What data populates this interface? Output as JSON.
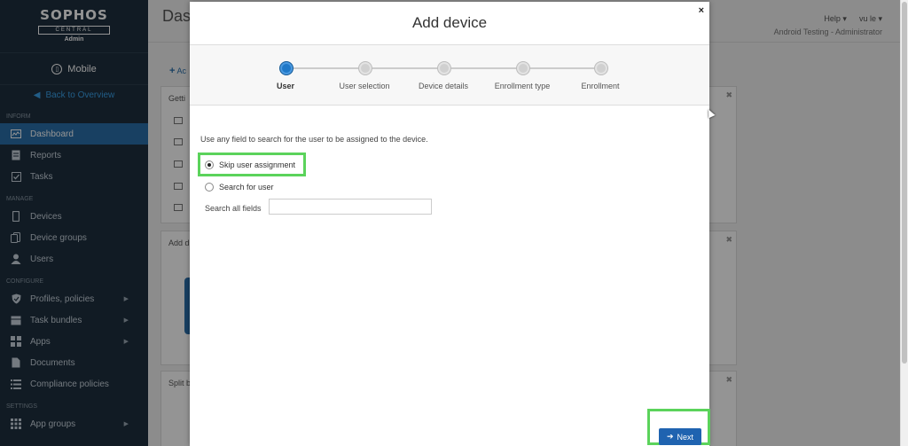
{
  "brand": {
    "logo": "SOPHOS",
    "central": "CENTRAL",
    "role": "Admin"
  },
  "product": "Mobile",
  "back_link": "Back to Overview",
  "sidebar": {
    "sections": [
      {
        "title": "INFORM",
        "items": [
          {
            "label": "Dashboard",
            "icon": "dashboard-icon",
            "active": true
          },
          {
            "label": "Reports",
            "icon": "reports-icon"
          },
          {
            "label": "Tasks",
            "icon": "tasks-icon"
          }
        ]
      },
      {
        "title": "MANAGE",
        "items": [
          {
            "label": "Devices",
            "icon": "device-icon"
          },
          {
            "label": "Device groups",
            "icon": "device-groups-icon"
          },
          {
            "label": "Users",
            "icon": "user-icon"
          }
        ]
      },
      {
        "title": "CONFIGURE",
        "items": [
          {
            "label": "Profiles, policies",
            "icon": "shield-icon",
            "arrow": true
          },
          {
            "label": "Task bundles",
            "icon": "task-bundles-icon",
            "arrow": true
          },
          {
            "label": "Apps",
            "icon": "apps-icon",
            "arrow": true
          },
          {
            "label": "Documents",
            "icon": "document-icon"
          },
          {
            "label": "Compliance policies",
            "icon": "list-icon"
          }
        ]
      },
      {
        "title": "SETTINGS",
        "items": [
          {
            "label": "App groups",
            "icon": "app-groups-icon",
            "arrow": true
          }
        ]
      }
    ]
  },
  "header": {
    "title": "Das",
    "help": "Help",
    "user": "vu le",
    "subtitle": "Android Testing - Administrator"
  },
  "main": {
    "add_link": "Ac",
    "cards": [
      {
        "title": "Getti"
      },
      {
        "title": "Add d"
      },
      {
        "title": "Split b"
      }
    ]
  },
  "modal": {
    "title": "Add device",
    "close": "×",
    "steps": [
      {
        "label": "User",
        "active": true
      },
      {
        "label": "User selection",
        "active": false
      },
      {
        "label": "Device details",
        "active": false
      },
      {
        "label": "Enrollment type",
        "active": false
      },
      {
        "label": "Enrollment",
        "active": false
      }
    ],
    "instruction": "Use any field to search for the user to be assigned to the device.",
    "options": {
      "skip": "Skip user assignment",
      "search": "Search for user",
      "selected": "skip"
    },
    "search_label": "Search all fields",
    "search_value": "",
    "search_placeholder": "",
    "next_label": "Next"
  },
  "colors": {
    "sidebar_bg": "#1e2f3f",
    "sidebar_active": "#2a6fa9",
    "accent": "#1f63b0",
    "highlight": "#5bd35b"
  }
}
